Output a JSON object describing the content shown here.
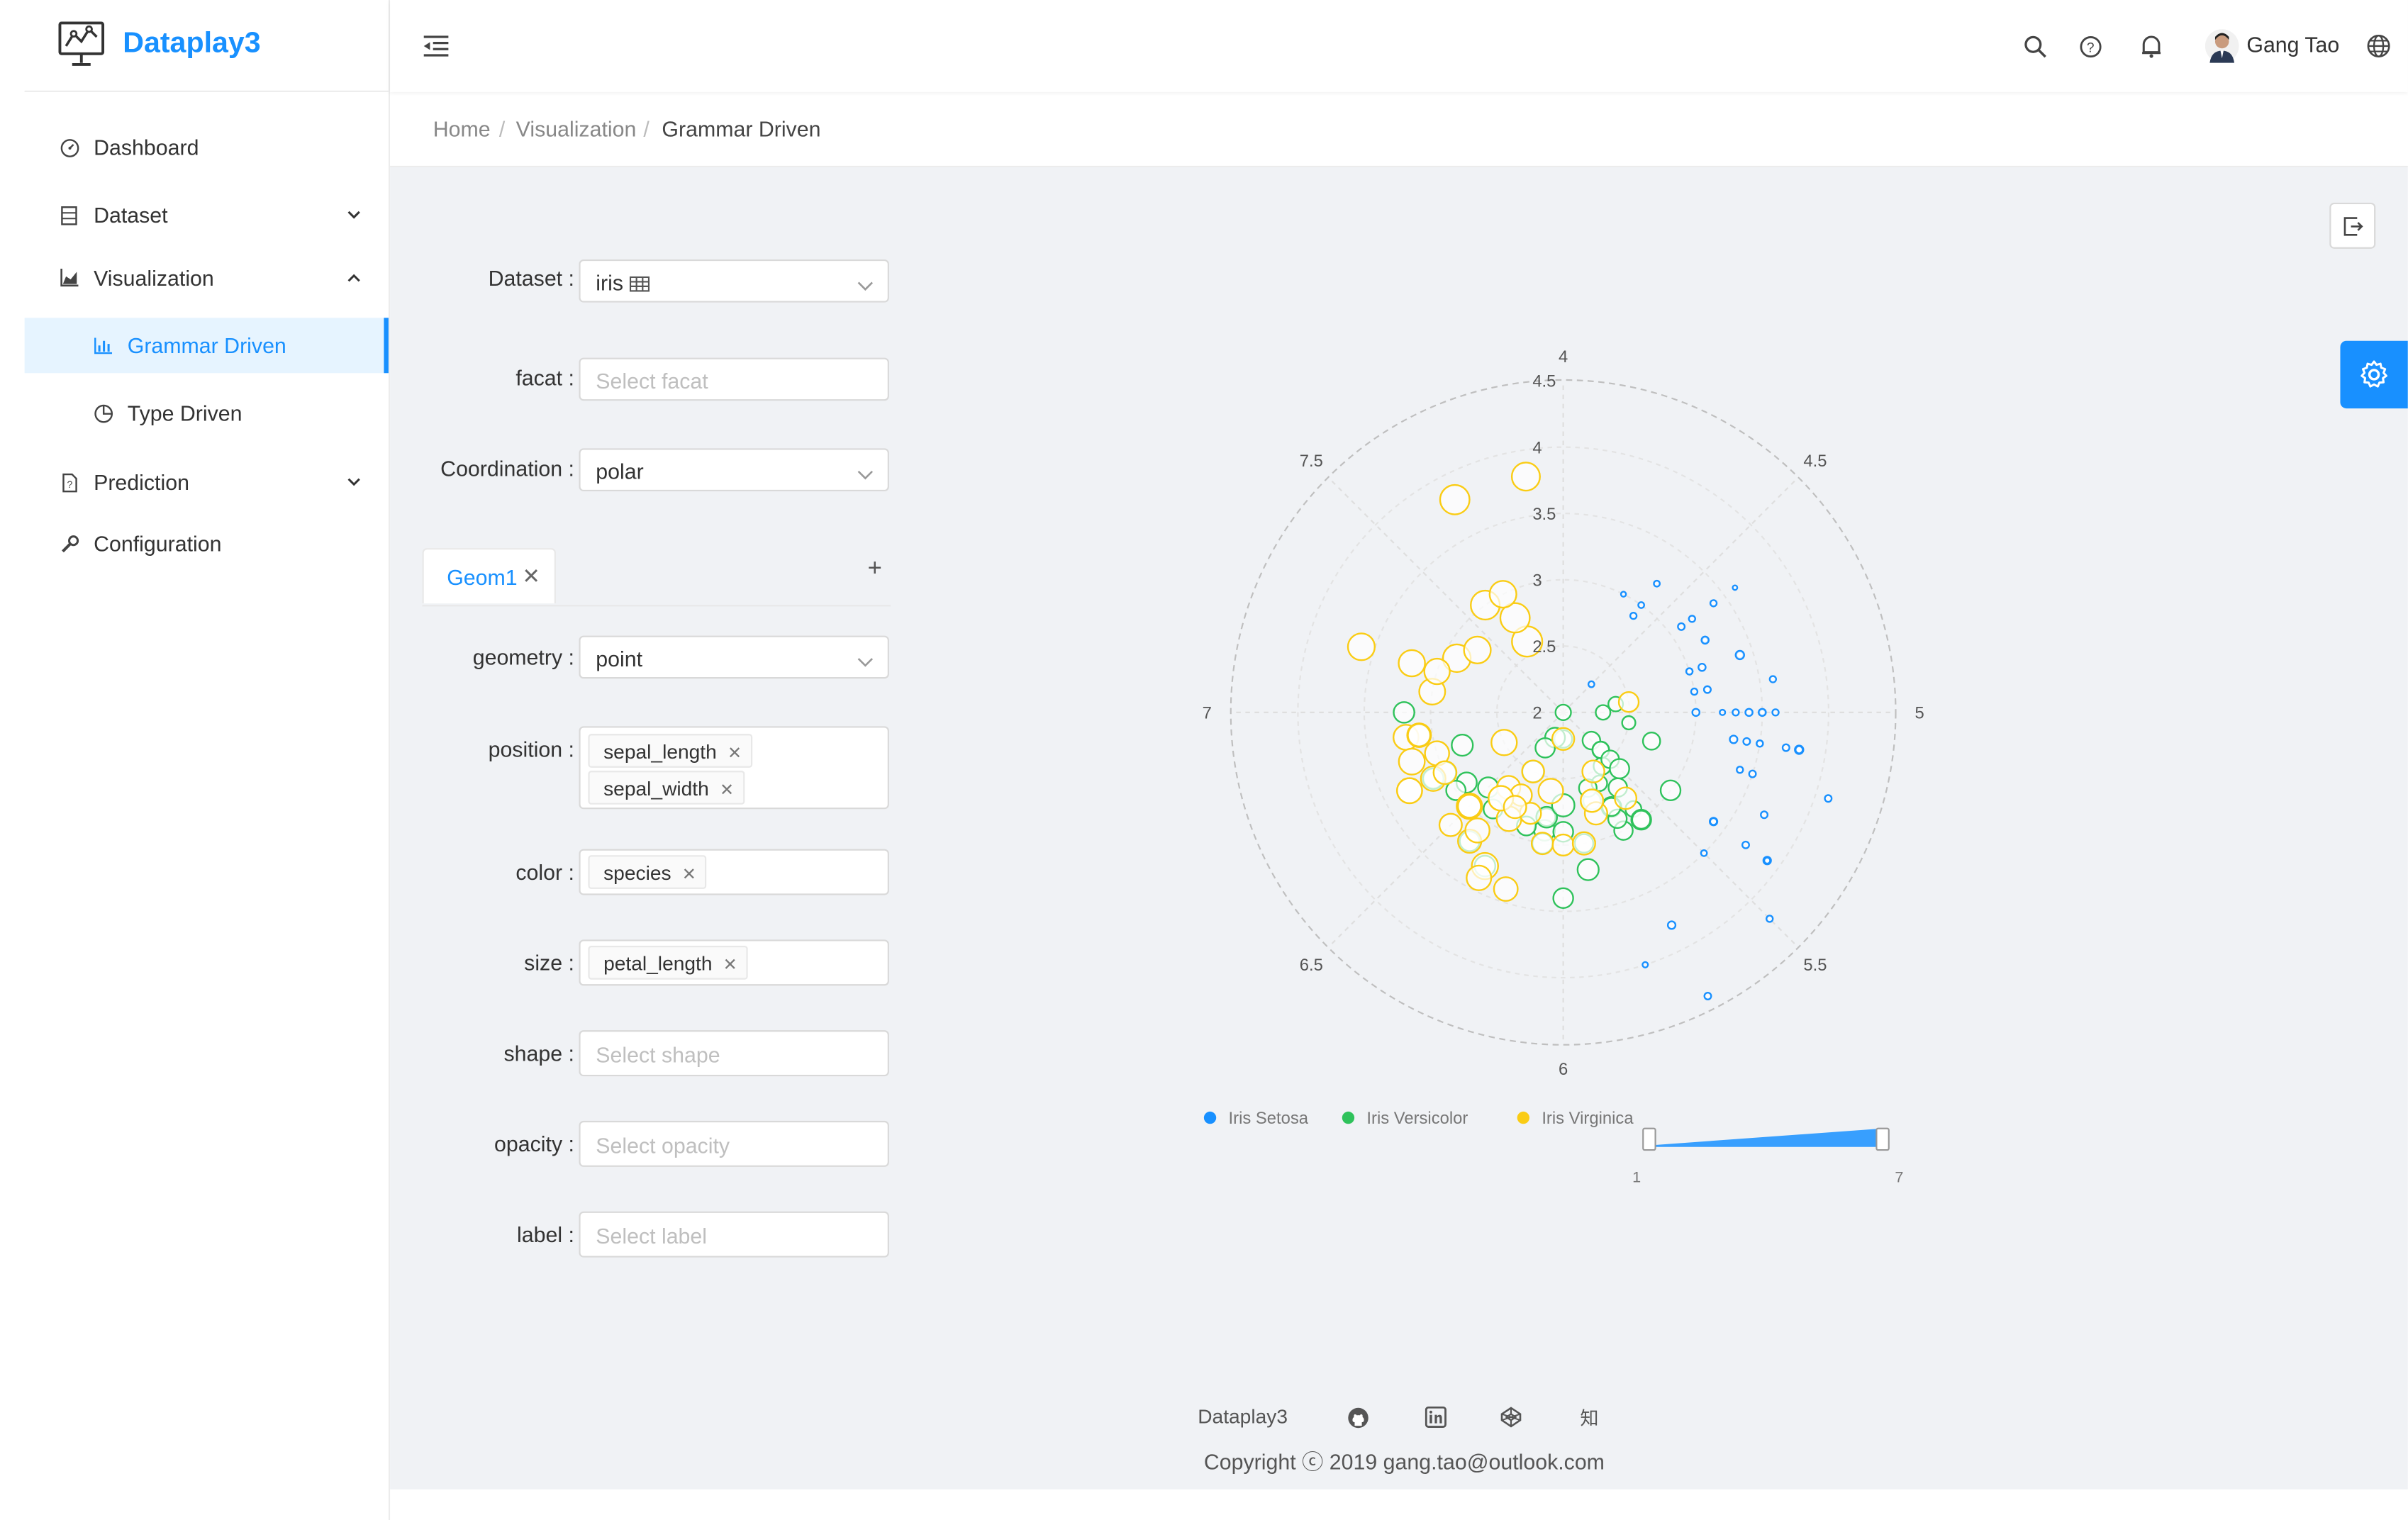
{
  "app": {
    "title": "Dataplay3"
  },
  "sidebar": {
    "items": [
      {
        "label": "Dashboard",
        "icon": "dashboard-icon"
      },
      {
        "label": "Dataset",
        "icon": "database-icon",
        "arrow": "chevron-down"
      },
      {
        "label": "Visualization",
        "icon": "area-chart-icon",
        "arrow": "chevron-up"
      },
      {
        "label": "Grammar Driven",
        "icon": "bar-chart-icon",
        "active": true
      },
      {
        "label": "Type Driven",
        "icon": "pie-chart-icon"
      },
      {
        "label": "Prediction",
        "icon": "file-unknown-icon",
        "arrow": "chevron-down"
      },
      {
        "label": "Configuration",
        "icon": "tool-icon"
      }
    ]
  },
  "header": {
    "user_name": "Gang Tao",
    "icons": [
      "menu-fold-icon",
      "search-icon",
      "question-circle-icon",
      "bell-icon",
      "avatar",
      "global-icon"
    ]
  },
  "breadcrumb": [
    "Home",
    "Visualization",
    "Grammar Driven"
  ],
  "form": {
    "dataset": {
      "label": "Dataset",
      "value": "iris"
    },
    "facat": {
      "label": "facat",
      "placeholder": "Select facat"
    },
    "coordination": {
      "label": "Coordination",
      "value": "polar"
    },
    "tab": {
      "label": "Geom1"
    },
    "geometry": {
      "label": "geometry",
      "value": "point"
    },
    "position": {
      "label": "position",
      "tags": [
        "sepal_length",
        "sepal_width"
      ]
    },
    "color": {
      "label": "color",
      "tags": [
        "species"
      ]
    },
    "size": {
      "label": "size",
      "tags": [
        "petal_length"
      ]
    },
    "shape": {
      "label": "shape",
      "placeholder": "Select shape"
    },
    "opacity": {
      "label": "opacity",
      "placeholder": "Select opacity"
    },
    "label": {
      "label": "label",
      "placeholder": "Select label"
    }
  },
  "chart_data": {
    "type": "scatter",
    "coordinate": "polar",
    "x_field": "sepal_length",
    "y_field": "sepal_width",
    "color_field": "species",
    "size_field": "petal_length",
    "angle_ticks": [
      "4",
      "4.5",
      "5",
      "5.5",
      "6",
      "6.5",
      "7",
      "7.5"
    ],
    "radius_ticks": [
      "2",
      "2.5",
      "3",
      "3.5",
      "4",
      "4.5"
    ],
    "angle_range": [
      4,
      8
    ],
    "radius_range": [
      2,
      4.5
    ],
    "colors": {
      "Iris Setosa": "#1890ff",
      "Iris Versicolor": "#2fc25b",
      "Iris Virginica": "#facc14"
    },
    "legend": [
      "Iris Setosa",
      "Iris Versicolor",
      "Iris Virginica"
    ],
    "legend_position": "bottom",
    "size_slider": {
      "min_label": "1",
      "max_label": "7",
      "range": [
        1,
        7
      ]
    },
    "series": [
      {
        "name": "Iris Setosa",
        "points": [
          [
            5.1,
            3.5,
            1.4
          ],
          [
            4.9,
            3.0,
            1.4
          ],
          [
            4.7,
            3.2,
            1.3
          ],
          [
            4.6,
            3.1,
            1.5
          ],
          [
            5.0,
            3.6,
            1.4
          ],
          [
            5.4,
            3.9,
            1.7
          ],
          [
            4.6,
            3.4,
            1.4
          ],
          [
            5.0,
            3.4,
            1.5
          ],
          [
            4.4,
            2.9,
            1.4
          ],
          [
            4.9,
            3.1,
            1.5
          ],
          [
            5.4,
            3.7,
            1.5
          ],
          [
            4.8,
            3.4,
            1.6
          ],
          [
            4.8,
            3.0,
            1.4
          ],
          [
            4.3,
            3.0,
            1.1
          ],
          [
            5.8,
            4.0,
            1.2
          ],
          [
            5.7,
            4.4,
            1.5
          ],
          [
            5.4,
            3.9,
            1.3
          ],
          [
            5.1,
            3.5,
            1.4
          ],
          [
            5.7,
            3.8,
            1.7
          ],
          [
            5.1,
            3.8,
            1.5
          ],
          [
            5.4,
            3.4,
            1.7
          ],
          [
            5.1,
            3.7,
            1.5
          ],
          [
            4.6,
            3.6,
            1.0
          ],
          [
            5.1,
            3.3,
            1.7
          ],
          [
            4.8,
            3.4,
            1.9
          ],
          [
            5.0,
            3.0,
            1.6
          ],
          [
            5.0,
            3.4,
            1.6
          ],
          [
            5.2,
            3.5,
            1.5
          ],
          [
            5.2,
            3.4,
            1.4
          ],
          [
            4.7,
            3.2,
            1.6
          ],
          [
            4.8,
            3.1,
            1.6
          ],
          [
            5.4,
            3.4,
            1.5
          ],
          [
            5.2,
            4.1,
            1.5
          ],
          [
            5.5,
            4.2,
            1.4
          ],
          [
            4.9,
            3.1,
            1.5
          ],
          [
            5.0,
            3.2,
            1.2
          ],
          [
            5.5,
            3.5,
            1.3
          ],
          [
            4.9,
            3.6,
            1.4
          ],
          [
            4.4,
            3.0,
            1.3
          ],
          [
            5.1,
            3.4,
            1.5
          ],
          [
            5.0,
            3.5,
            1.3
          ],
          [
            4.5,
            2.3,
            1.3
          ],
          [
            4.4,
            3.2,
            1.3
          ],
          [
            5.0,
            3.5,
            1.6
          ],
          [
            5.1,
            3.8,
            1.9
          ],
          [
            4.8,
            3.0,
            1.4
          ],
          [
            5.1,
            3.8,
            1.6
          ],
          [
            4.6,
            3.2,
            1.4
          ],
          [
            5.3,
            3.7,
            1.5
          ],
          [
            5.0,
            3.3,
            1.4
          ]
        ]
      },
      {
        "name": "Iris Versicolor",
        "points": [
          [
            7.0,
            3.2,
            4.7
          ],
          [
            6.4,
            3.2,
            4.5
          ],
          [
            6.9,
            3.1,
            4.9
          ],
          [
            5.5,
            2.3,
            4.0
          ],
          [
            6.5,
            2.8,
            4.6
          ],
          [
            5.7,
            2.8,
            4.5
          ],
          [
            6.3,
            3.3,
            4.7
          ],
          [
            4.9,
            2.4,
            3.3
          ],
          [
            6.6,
            2.9,
            4.6
          ],
          [
            5.2,
            2.7,
            3.9
          ],
          [
            5.0,
            2.0,
            3.5
          ],
          [
            5.9,
            3.0,
            4.2
          ],
          [
            6.0,
            2.2,
            4.0
          ],
          [
            6.1,
            2.9,
            4.7
          ],
          [
            5.6,
            2.9,
            3.6
          ],
          [
            6.7,
            3.1,
            4.4
          ],
          [
            5.6,
            3.0,
            4.5
          ],
          [
            5.8,
            2.7,
            4.1
          ],
          [
            6.2,
            2.2,
            4.5
          ],
          [
            5.6,
            2.5,
            3.9
          ],
          [
            5.9,
            3.2,
            4.8
          ],
          [
            6.1,
            2.8,
            4.0
          ],
          [
            6.3,
            2.5,
            4.9
          ],
          [
            6.1,
            2.8,
            4.7
          ],
          [
            6.4,
            2.9,
            4.3
          ],
          [
            6.6,
            3.0,
            4.4
          ],
          [
            6.8,
            2.8,
            4.8
          ],
          [
            6.7,
            3.0,
            5.0
          ],
          [
            6.0,
            2.9,
            4.5
          ],
          [
            5.7,
            2.6,
            3.5
          ],
          [
            5.5,
            2.4,
            3.8
          ],
          [
            5.5,
            2.4,
            3.7
          ],
          [
            5.8,
            2.7,
            3.9
          ],
          [
            6.0,
            2.7,
            5.1
          ],
          [
            5.4,
            3.0,
            4.5
          ],
          [
            6.0,
            3.4,
            4.5
          ],
          [
            6.7,
            3.1,
            4.7
          ],
          [
            6.3,
            2.3,
            4.4
          ],
          [
            5.6,
            3.0,
            4.1
          ],
          [
            5.5,
            2.5,
            4.0
          ],
          [
            5.5,
            2.6,
            4.4
          ],
          [
            6.1,
            3.0,
            4.6
          ],
          [
            5.8,
            2.6,
            4.0
          ],
          [
            5.0,
            2.3,
            3.3
          ],
          [
            5.6,
            2.7,
            4.2
          ],
          [
            5.7,
            3.0,
            4.2
          ],
          [
            5.7,
            2.9,
            4.2
          ],
          [
            6.2,
            2.9,
            4.3
          ],
          [
            5.1,
            2.5,
            3.0
          ],
          [
            5.7,
            2.8,
            4.1
          ]
        ]
      },
      {
        "name": "Iris Virginica",
        "points": [
          [
            6.3,
            3.3,
            6.0
          ],
          [
            5.8,
            2.7,
            5.1
          ],
          [
            7.1,
            3.0,
            5.9
          ],
          [
            6.3,
            2.9,
            5.6
          ],
          [
            6.5,
            3.0,
            5.8
          ],
          [
            7.6,
            3.0,
            6.6
          ],
          [
            4.9,
            2.5,
            4.5
          ],
          [
            7.3,
            2.9,
            6.3
          ],
          [
            6.7,
            2.5,
            5.8
          ],
          [
            7.2,
            3.6,
            6.1
          ],
          [
            6.5,
            3.2,
            5.1
          ],
          [
            6.4,
            2.7,
            5.3
          ],
          [
            6.8,
            3.0,
            5.5
          ],
          [
            5.7,
            2.5,
            5.0
          ],
          [
            5.8,
            2.8,
            5.1
          ],
          [
            6.4,
            3.2,
            5.3
          ],
          [
            6.5,
            3.0,
            5.5
          ],
          [
            7.7,
            3.8,
            6.7
          ],
          [
            7.7,
            2.6,
            6.9
          ],
          [
            6.0,
            2.2,
            5.0
          ],
          [
            6.9,
            3.2,
            5.7
          ],
          [
            5.6,
            2.8,
            4.9
          ],
          [
            7.7,
            2.8,
            6.7
          ],
          [
            6.3,
            2.7,
            4.9
          ],
          [
            6.7,
            3.3,
            5.7
          ],
          [
            7.2,
            3.2,
            6.0
          ],
          [
            6.2,
            2.8,
            4.8
          ],
          [
            6.1,
            3.0,
            4.9
          ],
          [
            6.4,
            2.8,
            5.6
          ],
          [
            7.2,
            3.0,
            5.8
          ],
          [
            7.4,
            2.8,
            6.1
          ],
          [
            7.9,
            3.8,
            6.4
          ],
          [
            6.4,
            2.8,
            5.6
          ],
          [
            6.3,
            2.8,
            5.1
          ],
          [
            6.1,
            2.6,
            5.6
          ],
          [
            7.7,
            3.0,
            6.1
          ],
          [
            6.3,
            3.4,
            5.6
          ],
          [
            6.4,
            3.1,
            5.5
          ],
          [
            6.0,
            3.0,
            4.8
          ],
          [
            6.9,
            3.1,
            5.4
          ],
          [
            6.7,
            3.1,
            5.6
          ],
          [
            6.9,
            3.1,
            5.1
          ],
          [
            5.8,
            2.7,
            5.1
          ],
          [
            6.8,
            3.2,
            5.9
          ],
          [
            6.7,
            3.3,
            5.7
          ],
          [
            6.7,
            3.0,
            5.2
          ],
          [
            6.3,
            2.5,
            5.0
          ],
          [
            6.5,
            3.0,
            5.2
          ],
          [
            6.2,
            3.4,
            5.4
          ],
          [
            5.9,
            3.0,
            5.1
          ]
        ]
      }
    ]
  },
  "footer": {
    "app_name": "Dataplay3",
    "links": [
      "github-icon",
      "linkedin-icon",
      "codepen-icon",
      "zhihu-icon"
    ],
    "zhihu_glyph": "知",
    "copyright": "Copyright ⓒ 2019 gang.tao@outlook.com"
  }
}
